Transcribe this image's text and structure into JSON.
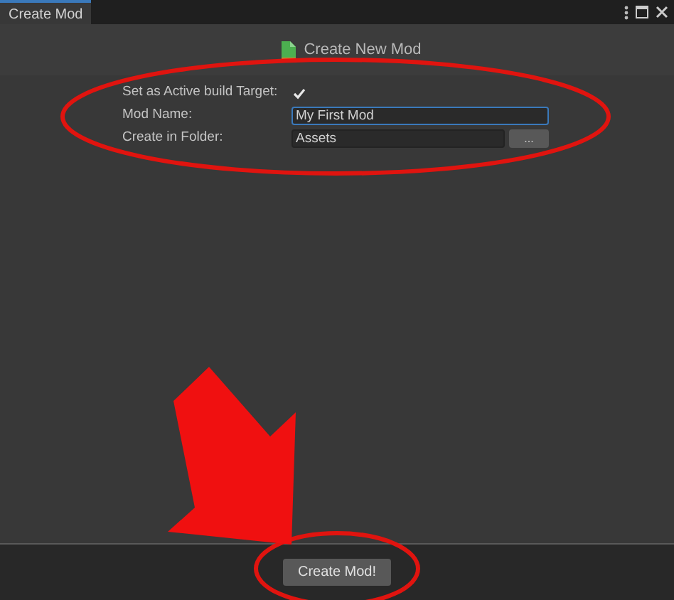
{
  "tab": {
    "label": "Create Mod",
    "selected": true
  },
  "header": {
    "title": "Create New Mod"
  },
  "form": [
    {
      "kind": "checkbox",
      "label": "Set as Active build Target:",
      "checked": true
    },
    {
      "kind": "text",
      "label": "Mod Name:",
      "value": "My First Mod",
      "focused": true
    },
    {
      "kind": "folder",
      "label": "Create in Folder:",
      "value": "Assets",
      "button": "..."
    }
  ],
  "footer": {
    "button": "Create Mod!"
  }
}
